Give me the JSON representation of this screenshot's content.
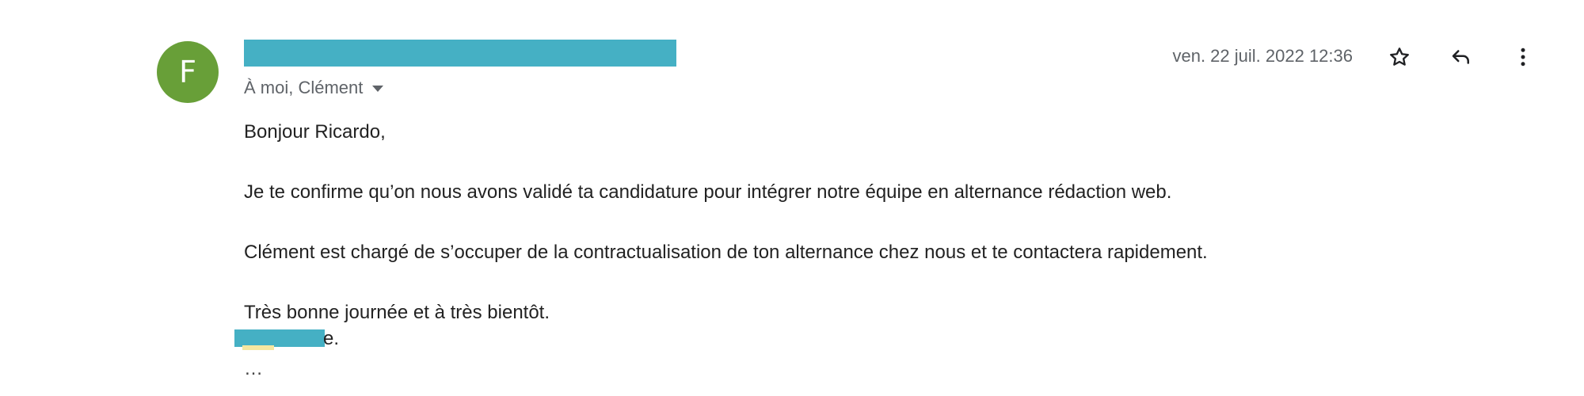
{
  "sender": {
    "avatar_letter": "F",
    "avatar_color": "#689f38",
    "redaction_color": "#45b0c4"
  },
  "recipients_label": "À moi, Clément",
  "date": "ven. 22 juil. 2022 12:36",
  "actions": {
    "star_icon": "star-icon",
    "reply_icon": "reply-icon",
    "more_icon": "more-vert-icon"
  },
  "body": {
    "greeting": "Bonjour Ricardo,",
    "paragraph1": "Je te confirme qu’on nous avons validé ta candidature pour intégrer notre équipe en alternance rédaction web.",
    "paragraph2": "Clément est chargé de s’occuper de la contractualisation de ton alternance chez nous et te contactera rapidement.",
    "closing": "Très bonne journée et à très bientôt.",
    "signature_tail": "e."
  },
  "trimmed_content": "…"
}
